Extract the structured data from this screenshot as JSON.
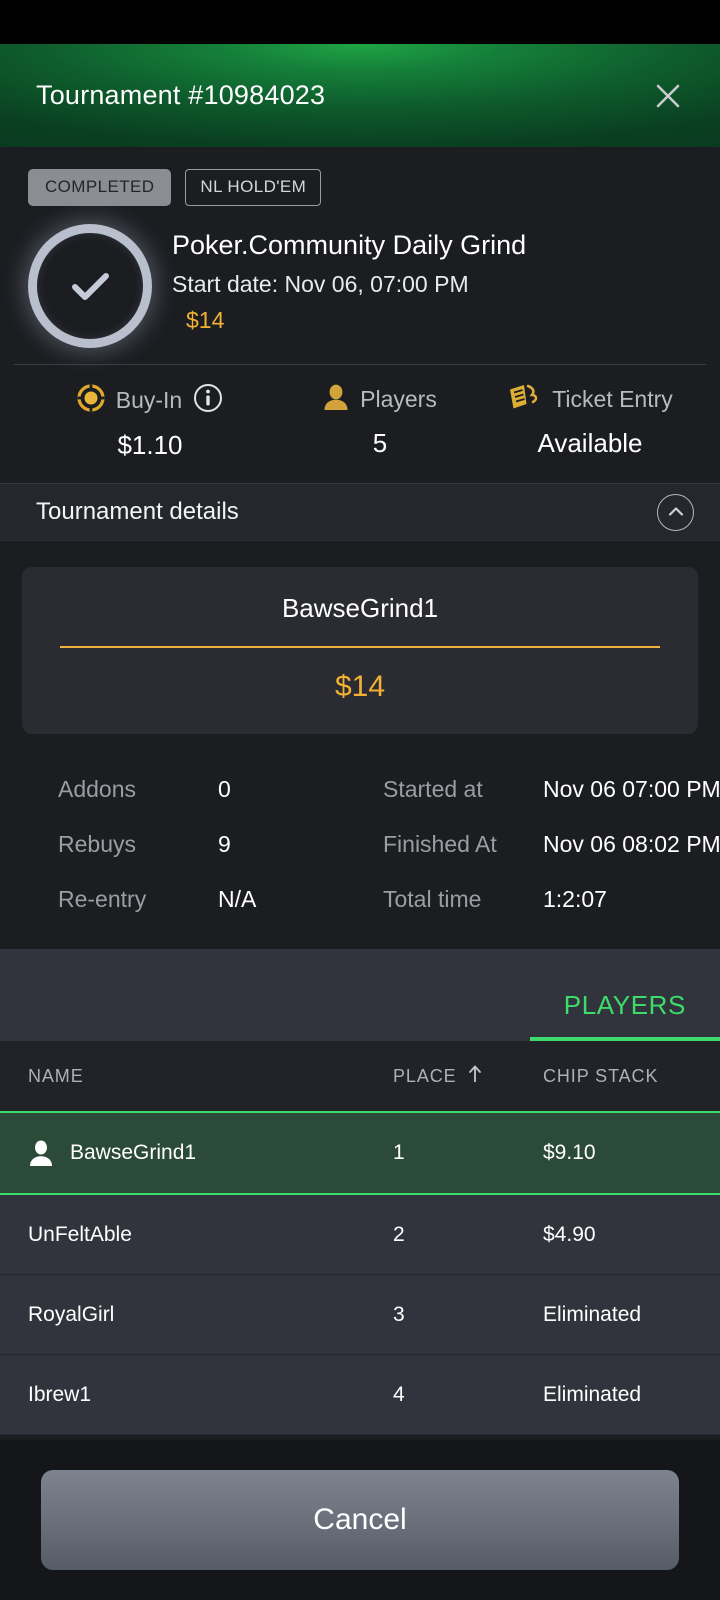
{
  "header": {
    "title": "Tournament #10984023",
    "close_icon": "close-icon"
  },
  "summary": {
    "status_badge": "COMPLETED",
    "variant_badge": "NL HOLD'EM",
    "status_icon": "check-circle-icon",
    "name": "Poker.Community Daily Grind",
    "start_date": "Start date: Nov 06, 07:00 PM",
    "prize": "$14",
    "stats": [
      {
        "icon": "poker-chip-icon",
        "label": "Buy-In",
        "value": "$1.10",
        "info_icon": "info-icon"
      },
      {
        "icon": "player-icon",
        "label": "Players",
        "value": "5"
      },
      {
        "icon": "ticket-icon",
        "label": "Ticket Entry",
        "value": "Available"
      }
    ]
  },
  "details": {
    "section_title": "Tournament details",
    "collapse_icon": "chevron-up-icon",
    "winner_name": "BawseGrind1",
    "winner_prize": "$14",
    "grid": [
      {
        "label": "Addons",
        "value": "0",
        "label2": "Started at",
        "value2": "Nov 06 07:00 PM"
      },
      {
        "label": "Rebuys",
        "value": "9",
        "label2": "Finished At",
        "value2": "Nov 06 08:02 PM"
      },
      {
        "label": "Re-entry",
        "value": "N/A",
        "label2": "Total time",
        "value2": "1:2:07"
      }
    ]
  },
  "tabs": [
    {
      "label": "PLAYERS",
      "active": true
    }
  ],
  "table": {
    "columns": {
      "name": "NAME",
      "place": "PLACE",
      "chip": "CHIP STACK",
      "sort_icon": "sort-arrow-up-icon"
    },
    "rows": [
      {
        "name": "BawseGrind1",
        "place": "1",
        "chip": "$9.10",
        "highlighted": true,
        "avatar_icon": "person-icon"
      },
      {
        "name": "UnFeltAble",
        "place": "2",
        "chip": "$4.90",
        "highlighted": false
      },
      {
        "name": "RoyalGirl",
        "place": "3",
        "chip": "Eliminated",
        "highlighted": false
      },
      {
        "name": "Ibrew1",
        "place": "4",
        "chip": "Eliminated",
        "highlighted": false
      }
    ]
  },
  "footer": {
    "cancel_label": "Cancel"
  },
  "colors": {
    "header_green": "#20a544",
    "accent_gold": "#f2b035",
    "accent_green": "#3ddc6a",
    "page_bg": "#1b1d21",
    "row_bg": "#31343c",
    "row_highlight": "#2c4a38"
  }
}
